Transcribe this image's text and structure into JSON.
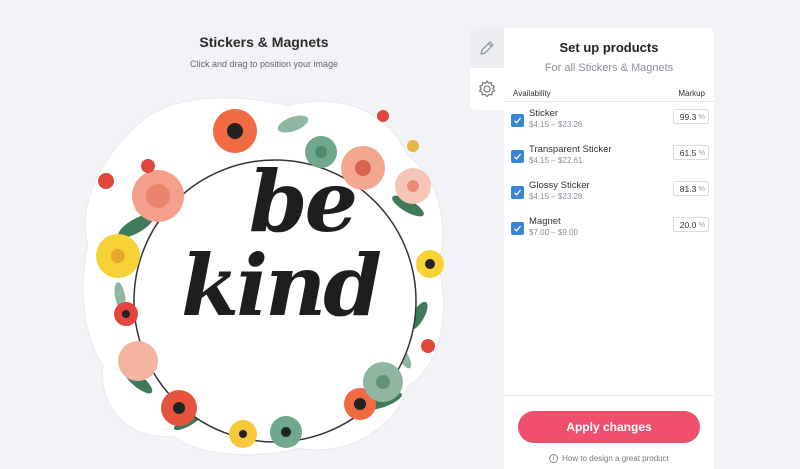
{
  "editor": {
    "title": "Stickers & Magnets",
    "subtitle": "Click and drag to position your image"
  },
  "design": {
    "word1": "be",
    "word2": "kind"
  },
  "side_tabs": [
    {
      "icon": "pencil-icon"
    },
    {
      "icon": "gear-icon",
      "active": true
    }
  ],
  "panel": {
    "title": "Set up products",
    "subtitle": "For all Stickers & Magnets",
    "col_availability": "Availability",
    "col_markup": "Markup",
    "products": [
      {
        "name": "Sticker",
        "range": "$4.15 – $23.26",
        "markup": "99.3",
        "unit": "%",
        "checked": true
      },
      {
        "name": "Transparent Sticker",
        "range": "$4.15 – $22.61",
        "markup": "61.5",
        "unit": "%",
        "checked": true
      },
      {
        "name": "Glossy Sticker",
        "range": "$4.15 – $23.28",
        "markup": "81.3",
        "unit": "%",
        "checked": true
      },
      {
        "name": "Magnet",
        "range": "$7.00 – $9.00",
        "markup": "20.0",
        "unit": "%",
        "checked": true
      }
    ],
    "apply_label": "Apply changes",
    "help_text": "How to design a great product"
  },
  "colors": {
    "accent_button": "#f0506e",
    "checkbox": "#3a85d6"
  }
}
